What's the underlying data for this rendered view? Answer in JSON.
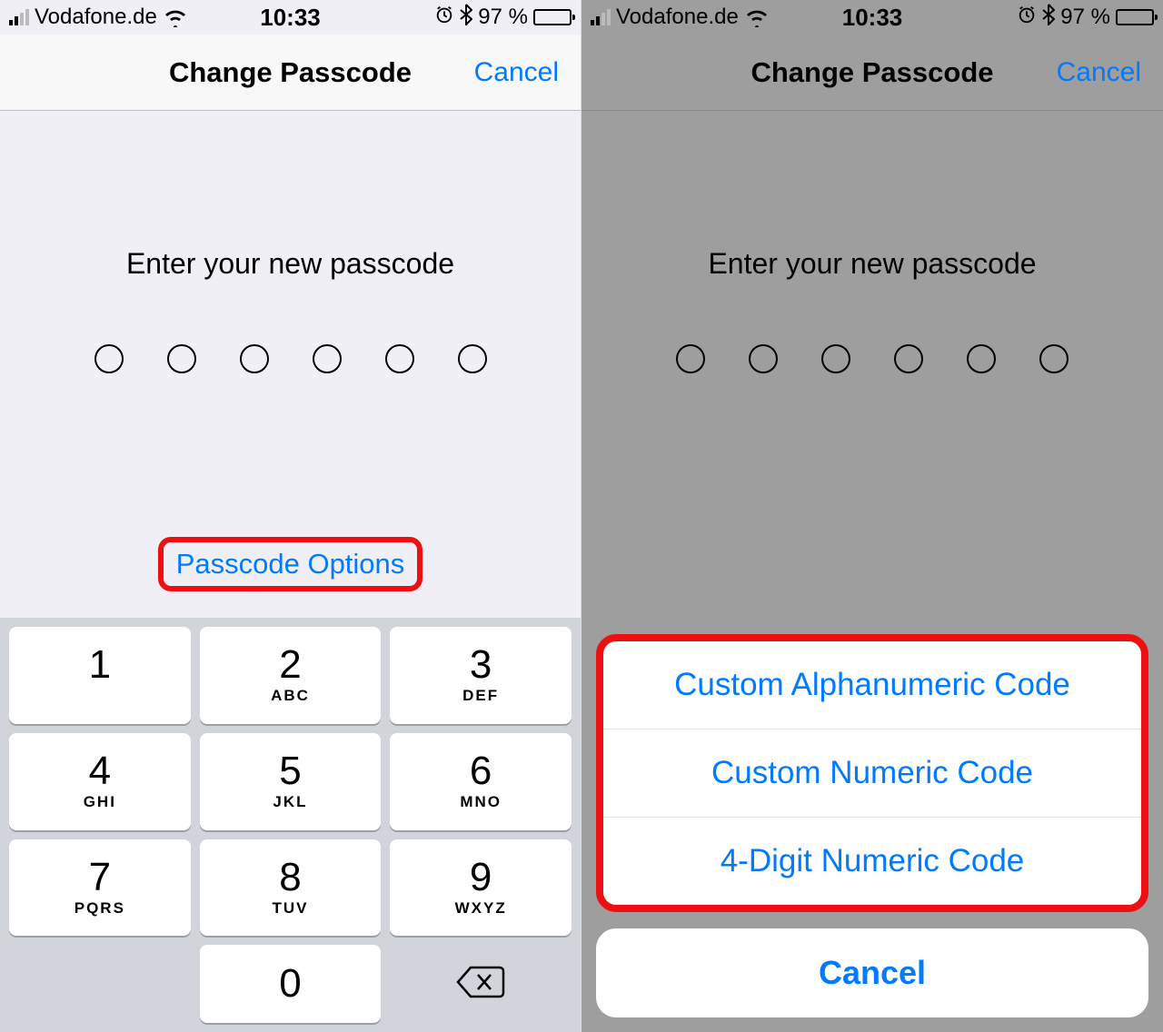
{
  "status": {
    "carrier": "Vodafone.de",
    "time": "10:33",
    "battery_pct": "97 %",
    "battery_fill_pct": 97
  },
  "header": {
    "title": "Change Passcode",
    "cancel": "Cancel"
  },
  "main": {
    "prompt": "Enter your new passcode",
    "passcode_options": "Passcode Options",
    "passcode_options_truncated": "Passcode Options"
  },
  "keypad": {
    "keys": [
      {
        "num": "1",
        "letters": ""
      },
      {
        "num": "2",
        "letters": "ABC"
      },
      {
        "num": "3",
        "letters": "DEF"
      },
      {
        "num": "4",
        "letters": "GHI"
      },
      {
        "num": "5",
        "letters": "JKL"
      },
      {
        "num": "6",
        "letters": "MNO"
      },
      {
        "num": "7",
        "letters": "PQRS"
      },
      {
        "num": "8",
        "letters": "TUV"
      },
      {
        "num": "9",
        "letters": "WXYZ"
      },
      {
        "num": "",
        "letters": ""
      },
      {
        "num": "0",
        "letters": ""
      },
      {
        "num": "",
        "letters": ""
      }
    ]
  },
  "sheet": {
    "options": [
      "Custom Alphanumeric Code",
      "Custom Numeric Code",
      "4-Digit Numeric Code"
    ],
    "cancel": "Cancel"
  },
  "colors": {
    "accent": "#007aff",
    "highlight": "#ee1010"
  }
}
